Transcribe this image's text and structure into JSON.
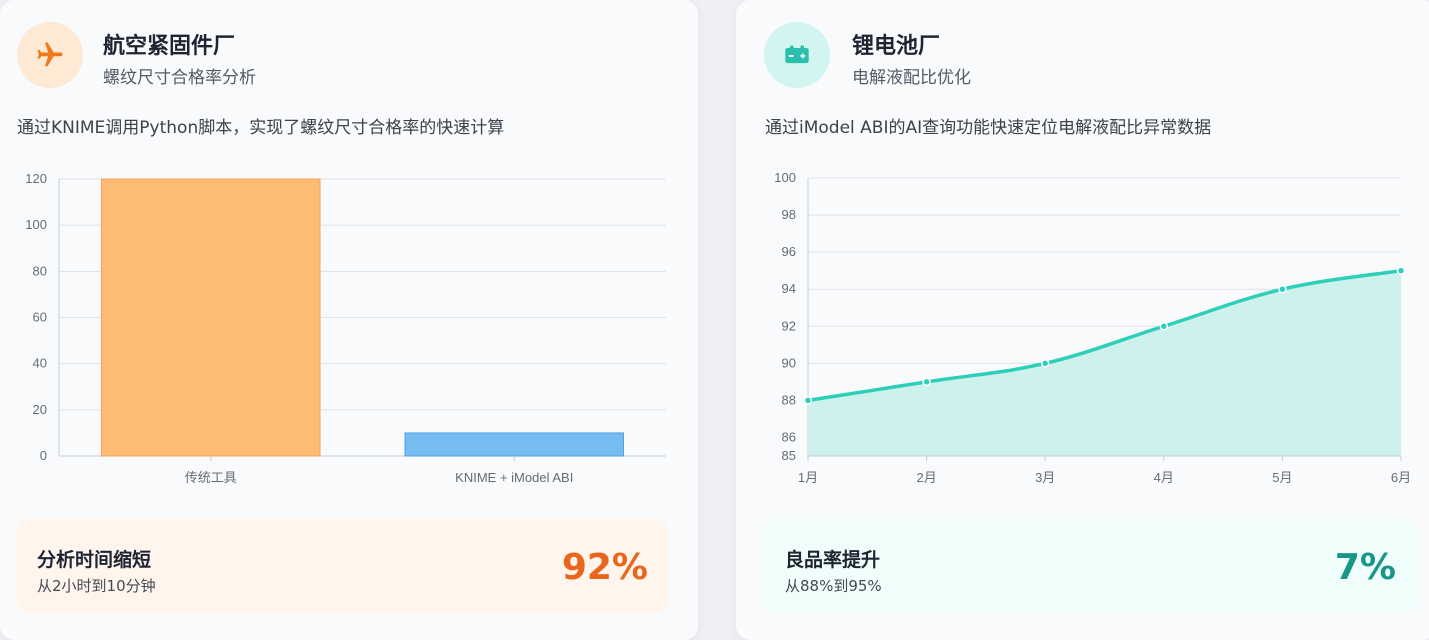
{
  "cards": [
    {
      "title": "航空紧固件厂",
      "subtitle": "螺纹尺寸合格率分析",
      "description": "通过KNIME调用Python脚本，实现了螺纹尺寸合格率的快速计算",
      "icon": "airplane-icon",
      "stat": {
        "label": "分析时间缩短",
        "sub": "从2小时到10分钟",
        "value": "92%"
      },
      "colors": {
        "accent": "#f07a1a",
        "icon_bg": "#fde9d4",
        "stat_bg": "#fff5ec",
        "value": "#e8671c"
      }
    },
    {
      "title": "锂电池厂",
      "subtitle": "电解液配比优化",
      "description": "通过iModel ABI的AI查询功能快速定位电解液配比异常数据",
      "icon": "battery-icon",
      "stat": {
        "label": "良品率提升",
        "sub": "从88%到95%",
        "value": "7%"
      },
      "colors": {
        "accent": "#2bbfae",
        "icon_bg": "#d2f5f1",
        "stat_bg": "#effdfb",
        "value": "#18968a"
      }
    }
  ],
  "chart_data": [
    {
      "type": "bar",
      "categories": [
        "传统工具",
        "KNIME + iModel ABI"
      ],
      "values": [
        120,
        10
      ],
      "ylim": [
        0,
        120
      ],
      "yticks": [
        0,
        20,
        40,
        60,
        80,
        100,
        120
      ],
      "grid": true,
      "colors": {
        "fills": [
          "#fdbb76",
          "#76bcf0"
        ],
        "strokes": [
          "#f4a55a",
          "#4ea3e6"
        ]
      }
    },
    {
      "type": "area",
      "categories": [
        "1月",
        "2月",
        "3月",
        "4月",
        "5月",
        "6月"
      ],
      "values": [
        88,
        89,
        90,
        92,
        94,
        95
      ],
      "ylim": [
        85,
        100
      ],
      "yticks": [
        85,
        86,
        88,
        90,
        92,
        94,
        96,
        98,
        100
      ],
      "grid": true,
      "colors": {
        "line": "#2ecfb9",
        "fill": "#cdf1ec"
      }
    }
  ]
}
